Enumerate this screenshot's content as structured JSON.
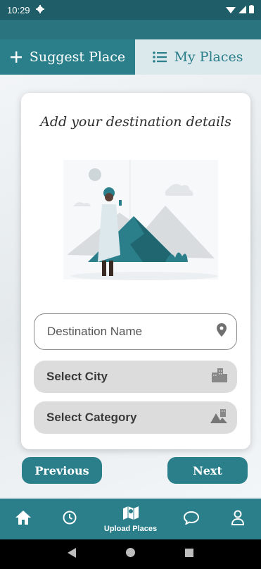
{
  "status": {
    "time": "10:29"
  },
  "tabs": [
    {
      "label": "Suggest Place",
      "icon": "plus-icon"
    },
    {
      "label": "My Places",
      "icon": "list-icon"
    }
  ],
  "card": {
    "title": "Add your destination details",
    "destination_placeholder": "Destination Name",
    "city_label": "Select City",
    "category_label": "Select Category"
  },
  "buttons": {
    "previous": "Previous",
    "next": "Next"
  },
  "bottom_nav": {
    "items": [
      {
        "icon": "home-icon"
      },
      {
        "icon": "clock-icon"
      },
      {
        "icon": "map-icon",
        "label": "Upload Places"
      },
      {
        "icon": "chat-icon"
      },
      {
        "icon": "person-icon"
      }
    ]
  },
  "colors": {
    "primary": "#2a7f8b",
    "status_bar": "#1f5e68",
    "tab_inactive": "#dce9ec"
  }
}
